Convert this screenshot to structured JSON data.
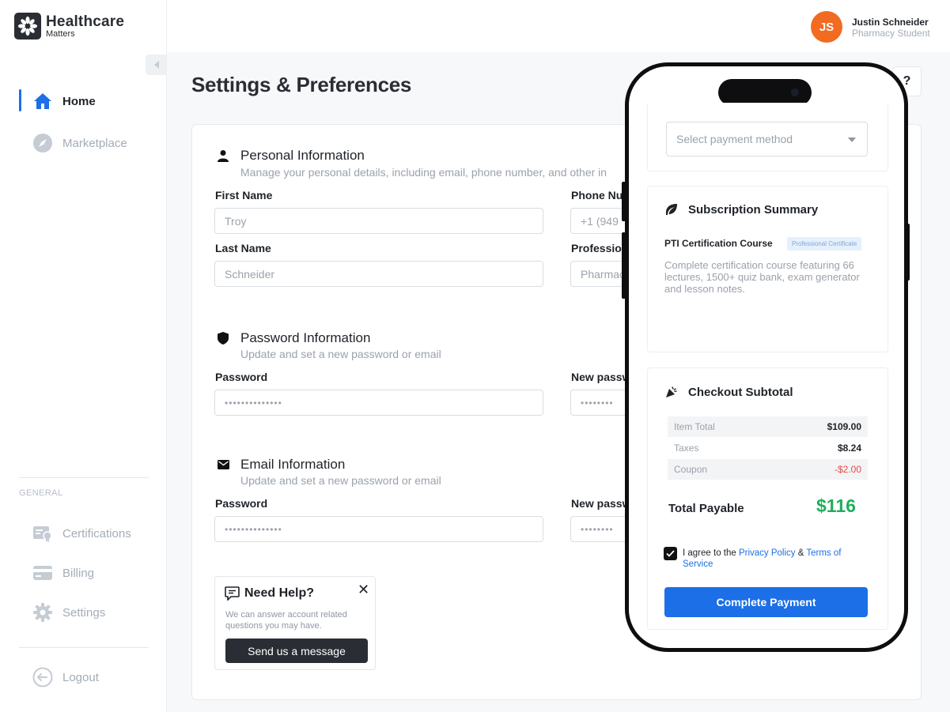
{
  "brand": {
    "title": "Healthcare",
    "subtitle": "Matters"
  },
  "user": {
    "initials": "JS",
    "name": "Justin Schneider",
    "role": "Pharmacy Student",
    "avatar_color": "#f26b21"
  },
  "sidebar": {
    "primary": [
      {
        "label": "Home",
        "icon": "home-icon",
        "active": true
      },
      {
        "label": "Marketplace",
        "icon": "compass-icon",
        "active": false
      }
    ],
    "general_label": "GENERAL",
    "general": [
      {
        "label": "Certifications",
        "icon": "certificate-icon"
      },
      {
        "label": "Billing",
        "icon": "credit-card-icon"
      },
      {
        "label": "Settings",
        "icon": "gear-icon"
      }
    ],
    "logout": {
      "label": "Logout",
      "icon": "logout-icon"
    }
  },
  "page": {
    "title": "Settings & Preferences",
    "help_glyph": "?"
  },
  "personal": {
    "title": "Personal Information",
    "subtitle": "Manage your personal details, including email, phone number, and other in",
    "first_name_label": "First Name",
    "first_name_value": "Troy",
    "last_name_label": "Last Name",
    "last_name_value": "Schneider",
    "phone_label": "Phone Num",
    "phone_value": "+1 (949",
    "profession_label": "Professio",
    "profession_value": "Pharmac"
  },
  "password": {
    "title": "Password Information",
    "subtitle": "Update and set a new password or email",
    "password_label": "Password",
    "password_value": "••••••••••••••",
    "new_label": "New passw",
    "new_value": "••••••••"
  },
  "email": {
    "title": "Email Information",
    "subtitle": "Update and set a new password or email",
    "password_label": "Password",
    "password_value": "••••••••••••••",
    "new_label": "New passw",
    "new_value": "••••••••"
  },
  "help": {
    "title": "Need Help?",
    "close": "✕",
    "text": "We can answer account related questions you may have.",
    "button": "Send us a message"
  },
  "checkout": {
    "payment_placeholder": "Select payment method",
    "summary_title": "Subscription Summary",
    "course_name": "PTI Certification Course",
    "course_badge": "Professional Certificate",
    "course_desc": "Complete certification course featuring 66 lectures, 1500+ quiz bank, exam generator and lesson notes.",
    "subtotal_title": "Checkout Subtotal",
    "lines": [
      {
        "label": "Item Total",
        "value": "$109.00"
      },
      {
        "label": "Taxes",
        "value": "$8.24"
      },
      {
        "label": "Coupon",
        "value": "-$2.00"
      }
    ],
    "total_label": "Total Payable",
    "total_value": "$116",
    "agree_prefix": "I agree to the ",
    "privacy_link": "Privacy Policy",
    "amp": " & ",
    "terms_link": "Terms of Service",
    "agree_checked": true,
    "pay_button": "Complete Payment",
    "accent_color": "#1c6fe6",
    "total_color": "#1fae5b",
    "coupon_color": "#e24b4b"
  }
}
